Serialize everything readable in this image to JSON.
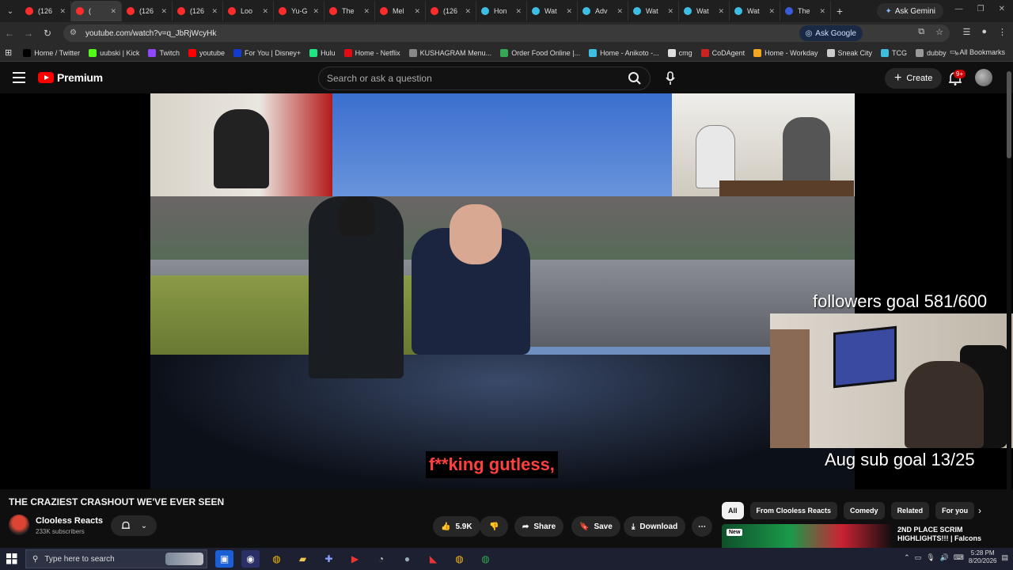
{
  "browser": {
    "tabs": [
      {
        "label": "(126",
        "color": "#ff2d2d",
        "active": false
      },
      {
        "label": "(",
        "color": "#ff2d2d",
        "active": true
      },
      {
        "label": "(126",
        "color": "#ff2d2d",
        "active": false
      },
      {
        "label": "(126",
        "color": "#ff2d2d",
        "active": false
      },
      {
        "label": "Loo",
        "color": "#ff2d2d",
        "active": false
      },
      {
        "label": "Yu-G",
        "color": "#ff2d2d",
        "active": false
      },
      {
        "label": "The",
        "color": "#ff2d2d",
        "active": false
      },
      {
        "label": "Mel",
        "color": "#ff2d2d",
        "active": false
      },
      {
        "label": "(126",
        "color": "#ff2d2d",
        "active": false
      },
      {
        "label": "Hon",
        "color": "#3dbde0",
        "active": false
      },
      {
        "label": "Wat",
        "color": "#3dbde0",
        "active": false
      },
      {
        "label": "Adv",
        "color": "#3dbde0",
        "active": false
      },
      {
        "label": "Wat",
        "color": "#3dbde0",
        "active": false
      },
      {
        "label": "Wat",
        "color": "#3dbde0",
        "active": false
      },
      {
        "label": "Wat",
        "color": "#3dbde0",
        "active": false
      },
      {
        "label": "The",
        "color": "#3a5bd9",
        "active": false
      }
    ],
    "ask_gemini": "Ask Gemini",
    "url": "youtube.com/watch?v=q_JbRjWcyHk",
    "ask_google": "Ask Google",
    "bookmarks": [
      {
        "label": "Home / Twitter",
        "color": "#000000"
      },
      {
        "label": "uubski | Kick",
        "color": "#53fc18"
      },
      {
        "label": "Twitch",
        "color": "#9146ff"
      },
      {
        "label": "youtube",
        "color": "#ff0000"
      },
      {
        "label": "For You | Disney+",
        "color": "#113ccf"
      },
      {
        "label": "Hulu",
        "color": "#1ce783"
      },
      {
        "label": "Home - Netflix",
        "color": "#e50914"
      },
      {
        "label": "KUSHAGRAM Menu...",
        "color": "#888888"
      },
      {
        "label": "Order Food Online |...",
        "color": "#34a853"
      },
      {
        "label": "Home - Anikoto -...",
        "color": "#3dbde0"
      },
      {
        "label": "cmg",
        "color": "#dddddd"
      },
      {
        "label": "CoDAgent",
        "color": "#cc2222"
      },
      {
        "label": "Home - Workday",
        "color": "#f5a623"
      },
      {
        "label": "Sneak City",
        "color": "#cccccc"
      },
      {
        "label": "TCG",
        "color": "#3dbde0"
      },
      {
        "label": "dubby",
        "color": "#999999"
      }
    ],
    "all_bookmarks": "All Bookmarks"
  },
  "youtube": {
    "logo_text": "Premium",
    "search_placeholder": "Search or ask a question",
    "create_label": "Create",
    "notif_badge": "9+"
  },
  "video": {
    "subtitle": "f**king gutless,",
    "overlay_followers": "followers goal 581/600",
    "overlay_subs": "Aug sub goal 13/25",
    "title": "THE CRAZIEST CRASHOUT WE'VE EVER SEEN",
    "channel_name": "Clooless Reacts",
    "subscribers": "233K subscribers",
    "likes": "5.9K",
    "share_label": "Share",
    "save_label": "Save",
    "download_label": "Download"
  },
  "recommendations": {
    "chips": [
      {
        "label": "All",
        "selected": true
      },
      {
        "label": "From Clooless Reacts",
        "selected": false
      },
      {
        "label": "Comedy",
        "selected": false
      },
      {
        "label": "Related",
        "selected": false
      },
      {
        "label": "For you",
        "selected": false
      }
    ],
    "first_item_title": "2ND PLACE SCRIM HIGHLIGHTS!!! | Falcons",
    "first_item_badge": "New"
  },
  "taskbar": {
    "search_placeholder": "Type here to search",
    "time": "5:28 PM",
    "date": "8/20/2026"
  }
}
